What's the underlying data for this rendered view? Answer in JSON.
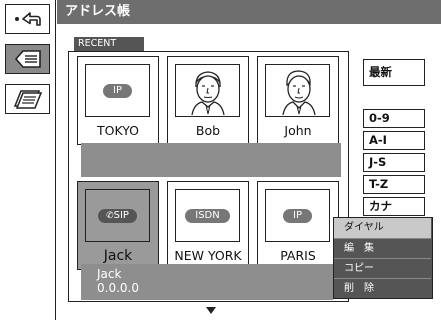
{
  "window": {
    "title": "アドレス帳"
  },
  "toolbar": {
    "back_icon": "back-arrow-icon",
    "address_icon": "address-card-icon",
    "book_icon": "address-book-icon"
  },
  "tab": {
    "label": "RECENT"
  },
  "contacts": [
    {
      "badge": "IP",
      "name": "TOKYO"
    },
    {
      "portrait": "man-portrait-icon",
      "name": "Bob"
    },
    {
      "portrait": "man-portrait-icon",
      "name": "John"
    },
    {
      "badge": "SIP",
      "name": "Jack",
      "selected": true
    },
    {
      "badge": "ISDN",
      "name": "NEW YORK"
    },
    {
      "badge": "IP",
      "name": "PARIS"
    }
  ],
  "info": {
    "name": "Jack",
    "address": "0.0.0.0"
  },
  "side_buttons": {
    "latest": "最新",
    "range1": "0-9",
    "range2": "A-I",
    "range3": "J-S",
    "range4": "T-Z",
    "range5": "カナ"
  },
  "menu": {
    "dial": "ダイヤル",
    "edit": "編　集",
    "copy": "コピー",
    "delete": "削　除"
  },
  "colors": {
    "title_bar": "#6e6e6e",
    "selected": "#9a9a9a",
    "menu_bg": "#555555",
    "menu_highlight": "#c9c9c9"
  }
}
